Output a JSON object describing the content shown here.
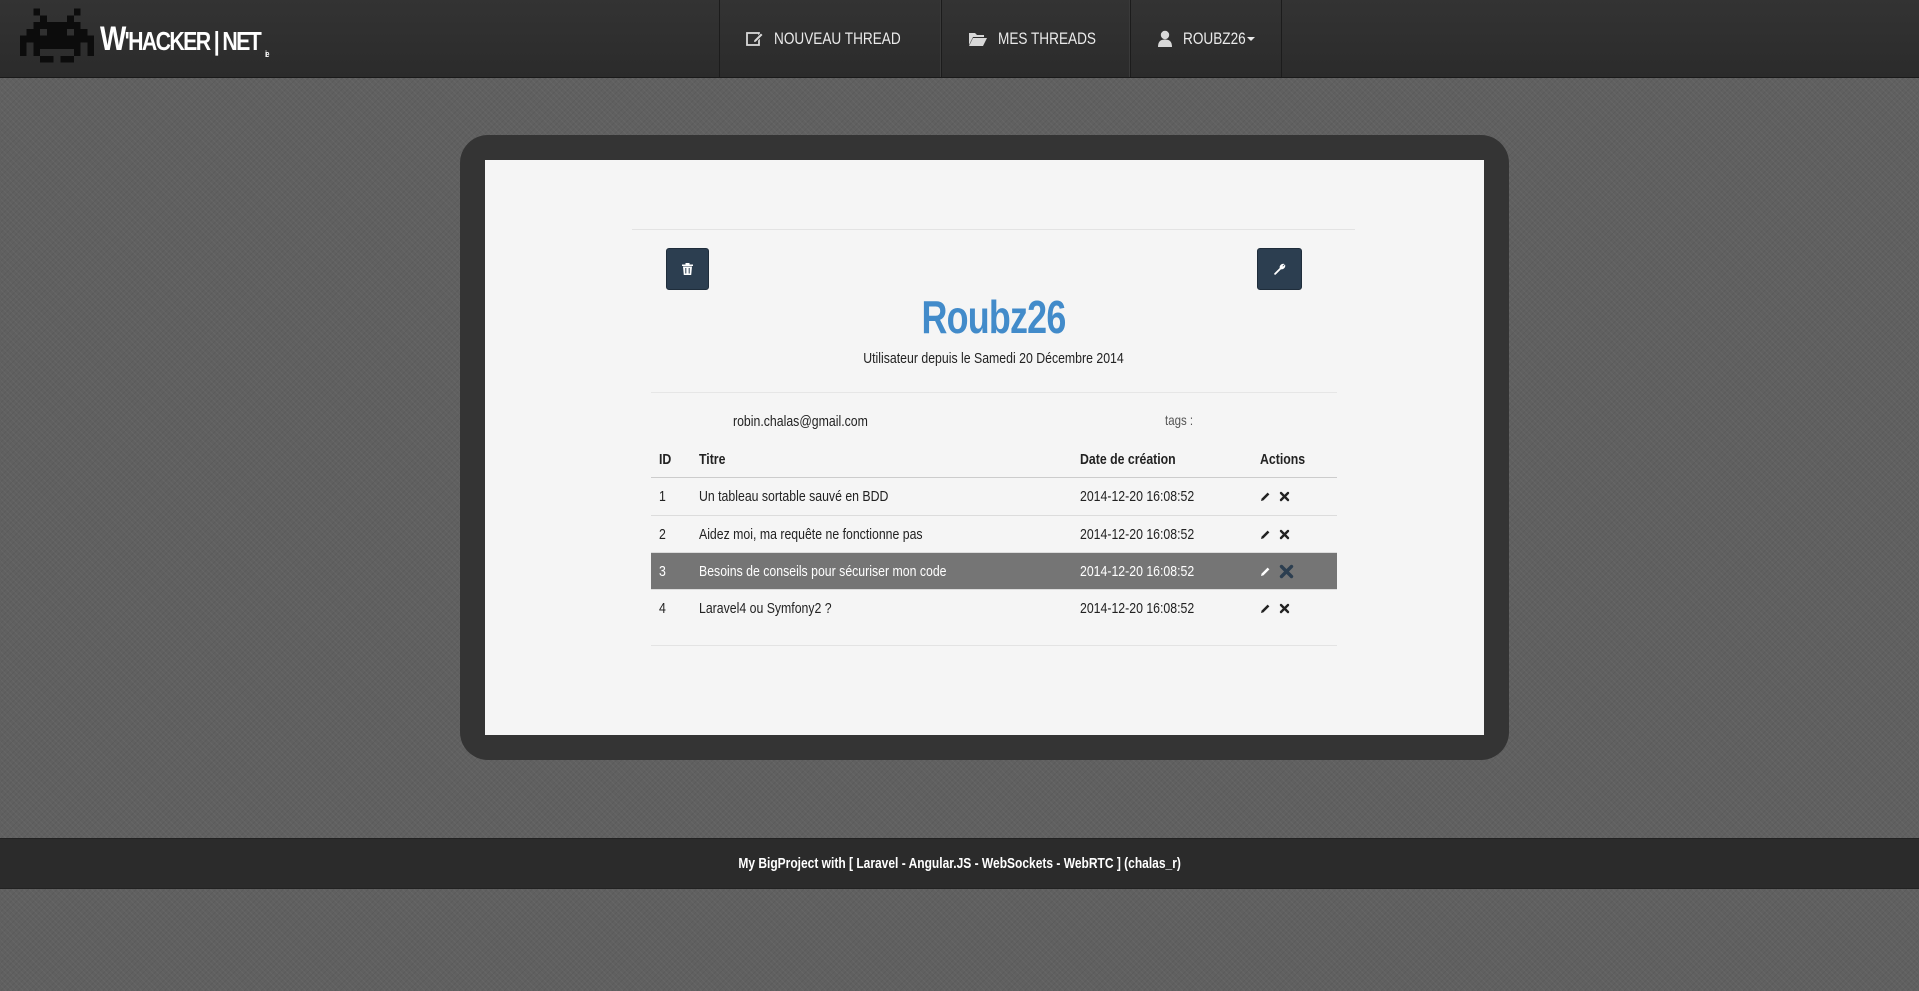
{
  "brand": {
    "text_w": "W",
    "text_main": "'HACKER | NET",
    "text_tiny": "ie",
    "logo_icon": "space-invader-icon"
  },
  "nav": {
    "items": [
      {
        "label": "NOUVEAU THREAD",
        "icon": "edit-icon"
      },
      {
        "label": "MES THREADS",
        "icon": "folder-open-icon"
      },
      {
        "label": "ROUBZ26",
        "icon": "user-icon"
      }
    ]
  },
  "profile": {
    "username": "Roubz26",
    "since": "Utilisateur depuis le Samedi 20 Décembre 2014",
    "email": "robin.chalas@gmail.com",
    "tags_label": "tags :",
    "delete_icon": "trash-icon",
    "settings_icon": "wrench-icon"
  },
  "table": {
    "headers": {
      "id": "ID",
      "title": "Titre",
      "date": "Date de création",
      "actions": "Actions"
    },
    "rows": [
      {
        "id": "1",
        "title": "Un tableau sortable sauvé en BDD",
        "date": "2014-12-20 16:08:52"
      },
      {
        "id": "2",
        "title": "Aidez moi, ma requête ne fonctionne pas",
        "date": "2014-12-20 16:08:52"
      },
      {
        "id": "3",
        "title": "Besoins de conseils pour sécuriser mon code",
        "date": "2014-12-20 16:08:52"
      },
      {
        "id": "4",
        "title": "Laravel4 ou Symfony2 ?",
        "date": "2014-12-20 16:08:52"
      }
    ]
  },
  "footer": {
    "text": "My BigProject with  [  Laravel - Angular.JS - WebSockets - WebRTC  ]   (chalas_r)"
  },
  "colors": {
    "accent": "#428bca",
    "button": "#2c3e50",
    "navbar": "#2e2e2e",
    "highlight_row": "#757575"
  }
}
